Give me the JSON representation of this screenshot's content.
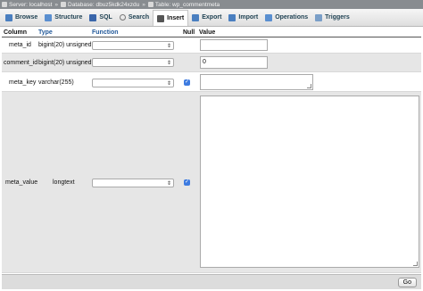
{
  "breadcrumb": [
    {
      "label": "Server: localhost",
      "icon": "server-icon"
    },
    {
      "label": "Database: dbuz5kdk24xzdu",
      "icon": "database-icon"
    },
    {
      "label": "Table: wp_commentmeta",
      "icon": "table-icon"
    }
  ],
  "breadcrumb_separator": "»",
  "tabs": [
    {
      "label": "Browse",
      "icon": "browse-icon",
      "color": "#4a7fc0"
    },
    {
      "label": "Structure",
      "icon": "structure-icon",
      "color": "#5a8fd0"
    },
    {
      "label": "SQL",
      "icon": "sql-icon",
      "color": "#3a66aa"
    },
    {
      "label": "Search",
      "icon": "search-icon",
      "color": "#777777"
    },
    {
      "label": "Insert",
      "icon": "insert-icon",
      "color": "#444444",
      "active": true
    },
    {
      "label": "Export",
      "icon": "export-icon",
      "color": "#4a7fc0"
    },
    {
      "label": "Import",
      "icon": "import-icon",
      "color": "#4a7fc0"
    },
    {
      "label": "Operations",
      "icon": "wrench-icon",
      "color": "#5a8fd0"
    },
    {
      "label": "Triggers",
      "icon": "triggers-icon",
      "color": "#7a9fc8"
    }
  ],
  "headers": {
    "column": "Column",
    "type": "Type",
    "function": "Function",
    "null": "Null",
    "value": "Value"
  },
  "rows": [
    {
      "column": "meta_id",
      "type": "bigint(20) unsigned",
      "function": "",
      "null_checked": false,
      "value": ""
    },
    {
      "column": "comment_id",
      "type": "bigint(20) unsigned",
      "function": "",
      "null_checked": false,
      "value": "0"
    },
    {
      "column": "meta_key",
      "type": "varchar(255)",
      "function": "",
      "null_checked": true,
      "value": ""
    },
    {
      "column": "meta_value",
      "type": "longtext",
      "function": "",
      "null_checked": true,
      "value": ""
    }
  ],
  "go_label": "Go",
  "checkbox_color": "#3d7be0"
}
